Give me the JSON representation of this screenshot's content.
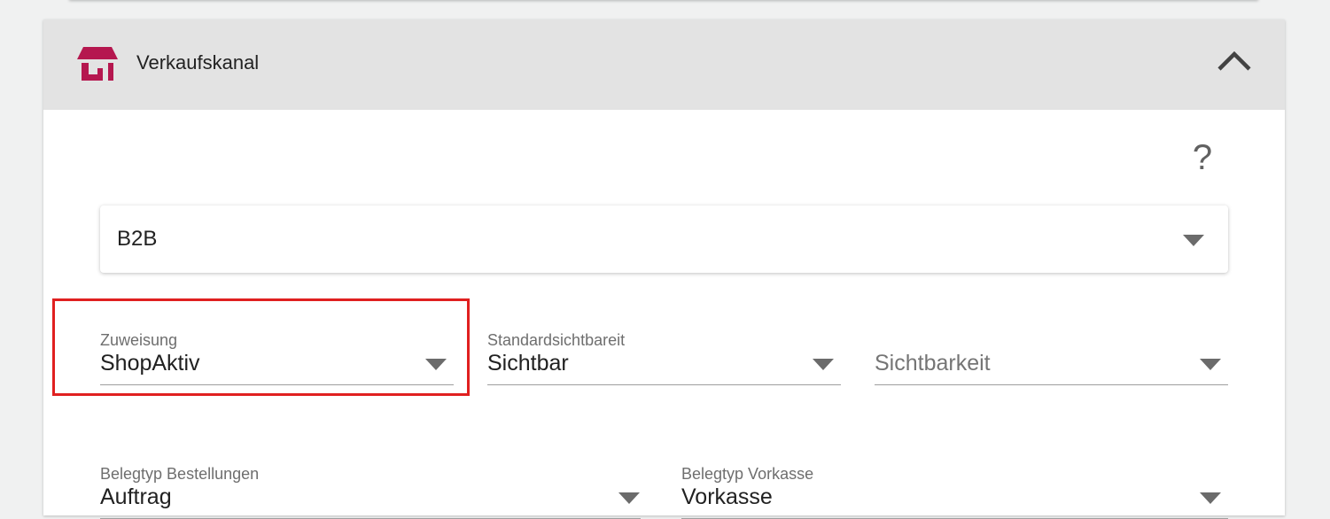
{
  "section": {
    "title": "Verkaufskanal",
    "icon": "storefront-icon",
    "collapse_icon": "chevron-up-icon",
    "accent_color": "#b5174f"
  },
  "help": {
    "label": "?"
  },
  "channel": {
    "value": "B2B"
  },
  "fields": {
    "zuweisung": {
      "label": "Zuweisung",
      "value": "ShopAktiv"
    },
    "standardsichtbarkeit": {
      "label": "Standardsichtbareit",
      "value": "Sichtbar"
    },
    "sichtbarkeit": {
      "placeholder": "Sichtbarkeit"
    },
    "belegtyp_bestellungen": {
      "label": "Belegtyp Bestellungen",
      "value": "Auftrag"
    },
    "belegtyp_vorkasse": {
      "label": "Belegtyp Vorkasse",
      "value": "Vorkasse"
    }
  },
  "highlight_color": "#e02020"
}
